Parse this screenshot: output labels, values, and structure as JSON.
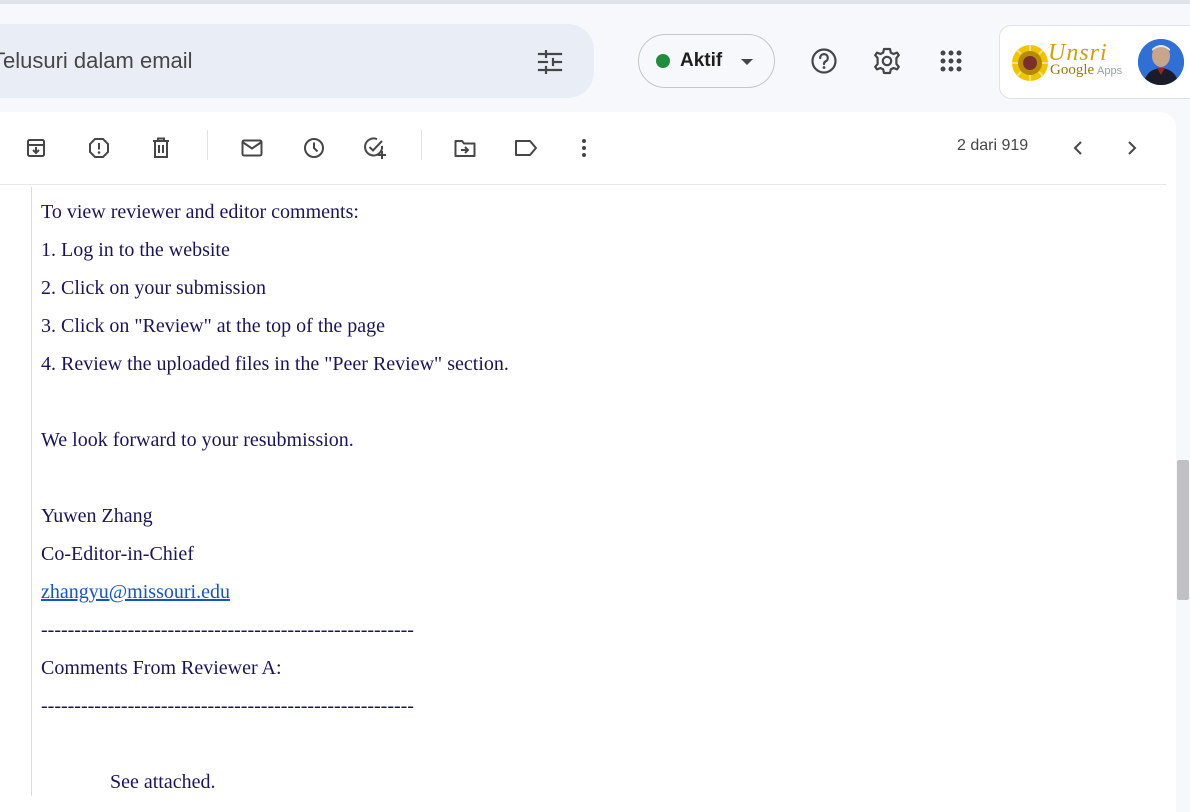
{
  "header": {
    "search": {
      "placeholder": "Telusuri dalam email"
    },
    "status": {
      "label": "Aktif",
      "color": "#1e8e3e"
    },
    "icons": [
      "filter-options-icon",
      "help-icon",
      "settings-icon",
      "apps-grid-icon"
    ],
    "account": {
      "org_logo_text_script": "Unsri",
      "org_logo_text_google": "Google",
      "org_logo_text_apps": "Apps"
    }
  },
  "toolbar": {
    "actions": [
      "archive",
      "report-spam",
      "delete",
      "mark-unread",
      "snooze",
      "add-to-tasks",
      "move-to",
      "label",
      "more"
    ],
    "pager_text": "2 dari 919"
  },
  "message": {
    "intro": "To view reviewer and editor comments:",
    "steps": [
      "1. Log in to the website",
      "2. Click on your submission",
      "3. Click on \"Review\" at the top of the page",
      "4. Review the uploaded files in the \"Peer Review\" section."
    ],
    "closing": "We look forward to your resubmission.",
    "signature_name": "Yuwen Zhang",
    "signature_title": "Co-Editor-in-Chief",
    "signature_email": "zhangyu@missouri.edu",
    "divider": "--------------------------------------------------------",
    "reviewer_heading": "Comments From Reviewer A:",
    "reviewer_comment": "See attached."
  }
}
